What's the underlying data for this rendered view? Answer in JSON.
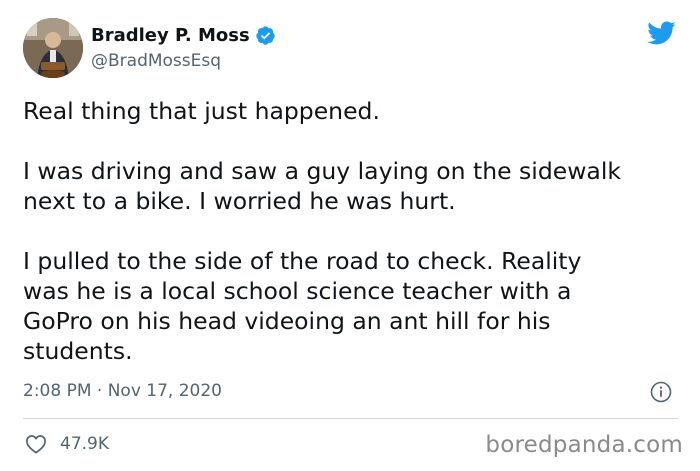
{
  "author": {
    "display_name": "Bradley P. Moss",
    "handle": "@BradMossEsq",
    "verified": true,
    "avatar_icon": "profile-photo"
  },
  "brand": {
    "logo_icon": "twitter-bird-icon",
    "logo_color": "#1d9bf0"
  },
  "tweet": {
    "paragraphs": [
      "Real thing that just happened.",
      "I was driving and saw a guy laying on the sidewalk\nnext to a bike. I worried he was hurt.",
      "I pulled to the side of the road to check. Reality\nwas he is a local school science teacher with a\nGoPro on his head videoing an ant hill for his\nstudents."
    ],
    "timestamp": "2:08 PM · Nov 17, 2020"
  },
  "engagement": {
    "likes": "47.9K"
  },
  "watermark": {
    "text": "boredpanda.com"
  },
  "colors": {
    "text_primary": "#0f1419",
    "text_secondary": "#536471",
    "verified_badge": "#1d9bf0",
    "divider": "#cfd9de",
    "watermark": "#8a8a8a"
  }
}
